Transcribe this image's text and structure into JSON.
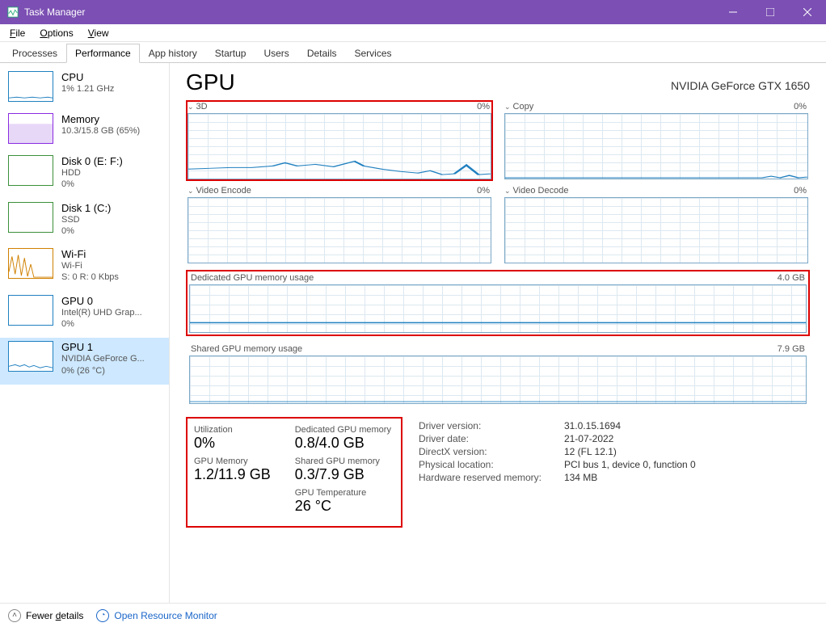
{
  "window": {
    "title": "Task Manager"
  },
  "menu": {
    "file": "File",
    "options": "Options",
    "view": "View"
  },
  "tabs": {
    "processes": "Processes",
    "performance": "Performance",
    "apphistory": "App history",
    "startup": "Startup",
    "users": "Users",
    "details": "Details",
    "services": "Services"
  },
  "sidebar": [
    {
      "name": "CPU",
      "sub": "1% 1.21 GHz",
      "type": "cpu"
    },
    {
      "name": "Memory",
      "sub": "10.3/15.8 GB (65%)",
      "type": "mem"
    },
    {
      "name": "Disk 0 (E: F:)",
      "sub": "HDD",
      "sub2": "0%",
      "type": "disk"
    },
    {
      "name": "Disk 1 (C:)",
      "sub": "SSD",
      "sub2": "0%",
      "type": "disk"
    },
    {
      "name": "Wi-Fi",
      "sub": "Wi-Fi",
      "sub2": "S: 0 R: 0 Kbps",
      "type": "wifi"
    },
    {
      "name": "GPU 0",
      "sub": "Intel(R) UHD Grap...",
      "sub2": "0%",
      "type": "gpu"
    },
    {
      "name": "GPU 1",
      "sub": "NVIDIA GeForce G...",
      "sub2": "0% (26 °C)",
      "type": "gpu",
      "selected": true
    }
  ],
  "header": {
    "title": "GPU",
    "device": "NVIDIA GeForce GTX 1650"
  },
  "engines": {
    "e0": {
      "name": "3D",
      "pct": "0%"
    },
    "e1": {
      "name": "Copy",
      "pct": "0%"
    },
    "e2": {
      "name": "Video Encode",
      "pct": "0%"
    },
    "e3": {
      "name": "Video Decode",
      "pct": "0%"
    }
  },
  "mem": {
    "ded_label": "Dedicated GPU memory usage",
    "ded_max": "4.0 GB",
    "shared_label": "Shared GPU memory usage",
    "shared_max": "7.9 GB"
  },
  "stats": {
    "util_l": "Utilization",
    "util_v": "0%",
    "ded_l": "Dedicated GPU memory",
    "ded_v": "0.8/4.0 GB",
    "gmem_l": "GPU Memory",
    "gmem_v": "1.2/11.9 GB",
    "shared_l": "Shared GPU memory",
    "shared_v": "0.3/7.9 GB",
    "temp_l": "GPU Temperature",
    "temp_v": "26 °C"
  },
  "info": {
    "r0k": "Driver version:",
    "r0v": "31.0.15.1694",
    "r1k": "Driver date:",
    "r1v": "21-07-2022",
    "r2k": "DirectX version:",
    "r2v": "12 (FL 12.1)",
    "r3k": "Physical location:",
    "r3v": "PCI bus 1, device 0, function 0",
    "r4k": "Hardware reserved memory:",
    "r4v": "134 MB"
  },
  "footer": {
    "fewer": "Fewer details",
    "monitor": "Open Resource Monitor"
  },
  "chart_data": {
    "type": "line",
    "title": "GPU engine utilization & memory",
    "series": [
      {
        "name": "3D",
        "ylim": [
          0,
          100
        ],
        "values": [
          14,
          15,
          16,
          15,
          17,
          18,
          20,
          22,
          19,
          20,
          18,
          22,
          26,
          20,
          17,
          14,
          13,
          12,
          10,
          8,
          7,
          6,
          7,
          11,
          6,
          5,
          5,
          22,
          5
        ]
      },
      {
        "name": "Copy",
        "ylim": [
          0,
          100
        ],
        "values": [
          0,
          0,
          0,
          0,
          0,
          0,
          0,
          0,
          0,
          0,
          0,
          0,
          0,
          0,
          0,
          0,
          0,
          0,
          0,
          0,
          0,
          0,
          0,
          0,
          0,
          2,
          0,
          3,
          1
        ]
      },
      {
        "name": "Video Encode",
        "ylim": [
          0,
          100
        ],
        "values": [
          0,
          0,
          0,
          0,
          0,
          0,
          0,
          0,
          0,
          0,
          0,
          0,
          0,
          0,
          0,
          0,
          0,
          0,
          0,
          0,
          0,
          0,
          0,
          0,
          0,
          0,
          0,
          0,
          0
        ]
      },
      {
        "name": "Video Decode",
        "ylim": [
          0,
          100
        ],
        "values": [
          0,
          0,
          0,
          0,
          0,
          0,
          0,
          0,
          0,
          0,
          0,
          0,
          0,
          0,
          0,
          0,
          0,
          0,
          0,
          0,
          0,
          0,
          0,
          0,
          0,
          0,
          0,
          0,
          0
        ]
      },
      {
        "name": "Dedicated GPU memory usage",
        "ylim": [
          0,
          4.0
        ],
        "unit": "GB",
        "values": [
          0.8,
          0.8,
          0.8,
          0.8,
          0.8,
          0.8,
          0.8,
          0.8,
          0.8,
          0.8,
          0.8,
          0.8,
          0.8,
          0.8,
          0.8,
          0.8,
          0.8,
          0.8,
          0.8,
          0.8,
          0.8,
          0.8,
          0.8,
          0.8,
          0.8,
          0.8,
          0.8,
          0.8,
          0.8
        ]
      },
      {
        "name": "Shared GPU memory usage",
        "ylim": [
          0,
          7.9
        ],
        "unit": "GB",
        "values": [
          0.3,
          0.3,
          0.3,
          0.3,
          0.3,
          0.3,
          0.3,
          0.3,
          0.3,
          0.3,
          0.3,
          0.3,
          0.3,
          0.3,
          0.3,
          0.3,
          0.3,
          0.3,
          0.3,
          0.3,
          0.3,
          0.3,
          0.3,
          0.3,
          0.3,
          0.3,
          0.3,
          0.3,
          0.3
        ]
      }
    ]
  }
}
